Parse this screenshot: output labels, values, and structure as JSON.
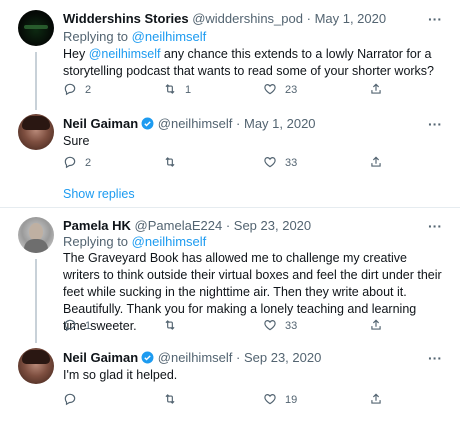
{
  "tweets": [
    {
      "name": "Widdershins Stories",
      "handle": "@widdershins_pod",
      "sep": "·",
      "date": "May 1, 2020",
      "replying_prefix": "Replying to",
      "replying_to": "@neilhimself",
      "text_prefix": "Hey ",
      "text_mention": "@neilhimself",
      "text_rest": " any chance this extends to a lowly Narrator for a storytelling podcast that wants to read some of your shorter works?",
      "replies": "2",
      "retweets": "1",
      "likes": "23"
    },
    {
      "name": "Neil Gaiman",
      "handle": "@neilhimself",
      "sep": "·",
      "date": "May 1, 2020",
      "text": "Sure",
      "replies": "2",
      "retweets": "",
      "likes": "33",
      "show_replies": "Show replies"
    },
    {
      "name": "Pamela HK",
      "handle": "@PamelaE224",
      "sep": "·",
      "date": "Sep 23, 2020",
      "replying_prefix": "Replying to",
      "replying_to": "@neilhimself",
      "text": "The Graveyard Book has allowed me to challenge my creative writers to think outside their virtual boxes and feel the dirt under their feet while sucking in the nighttime air.  Then they write about it. Beautifully. Thank you for making a lonely teaching and learning time sweeter.",
      "replies": "1",
      "retweets": "",
      "likes": "33"
    },
    {
      "name": "Neil Gaiman",
      "handle": "@neilhimself",
      "sep": "·",
      "date": "Sep 23, 2020",
      "text": "I'm so glad it helped.",
      "replies": "",
      "retweets": "",
      "likes": "19"
    }
  ],
  "icons": {
    "reply": "reply-icon",
    "retweet": "retweet-icon",
    "like": "heart-icon",
    "share": "share-icon",
    "verified": "verified-badge-icon",
    "more": "more-options-icon"
  },
  "colors": {
    "link": "#1d9bf0",
    "muted": "#536471",
    "verified": "#1d9bf0"
  }
}
